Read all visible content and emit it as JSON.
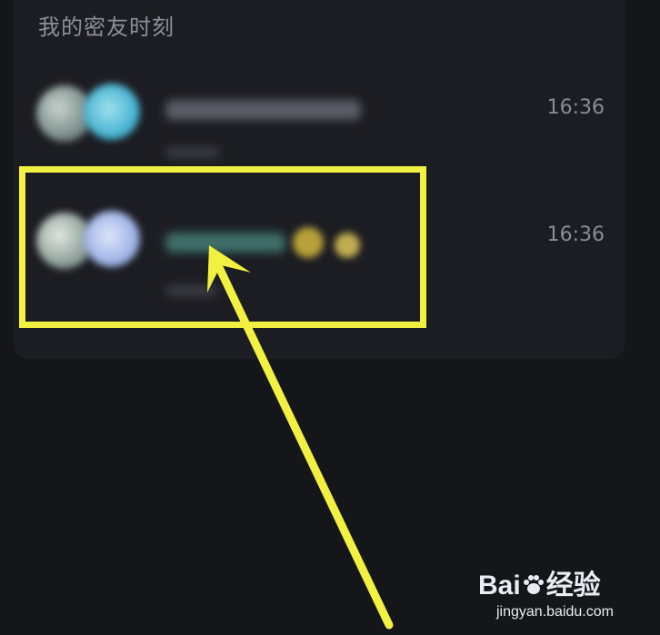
{
  "section": {
    "title": "我的密友时刻"
  },
  "moments": [
    {
      "time": "16:36"
    },
    {
      "time": "16:36"
    }
  ],
  "watermark": {
    "brand_left": "Bai",
    "brand_right": "经验",
    "site": "jingyan.baidu.com"
  },
  "colors": {
    "background": "#15161a",
    "panel": "#1c1d22",
    "highlight": "#f2f040"
  },
  "icons": {
    "annotation": "arrow-icon",
    "watermark": "paw-icon"
  }
}
